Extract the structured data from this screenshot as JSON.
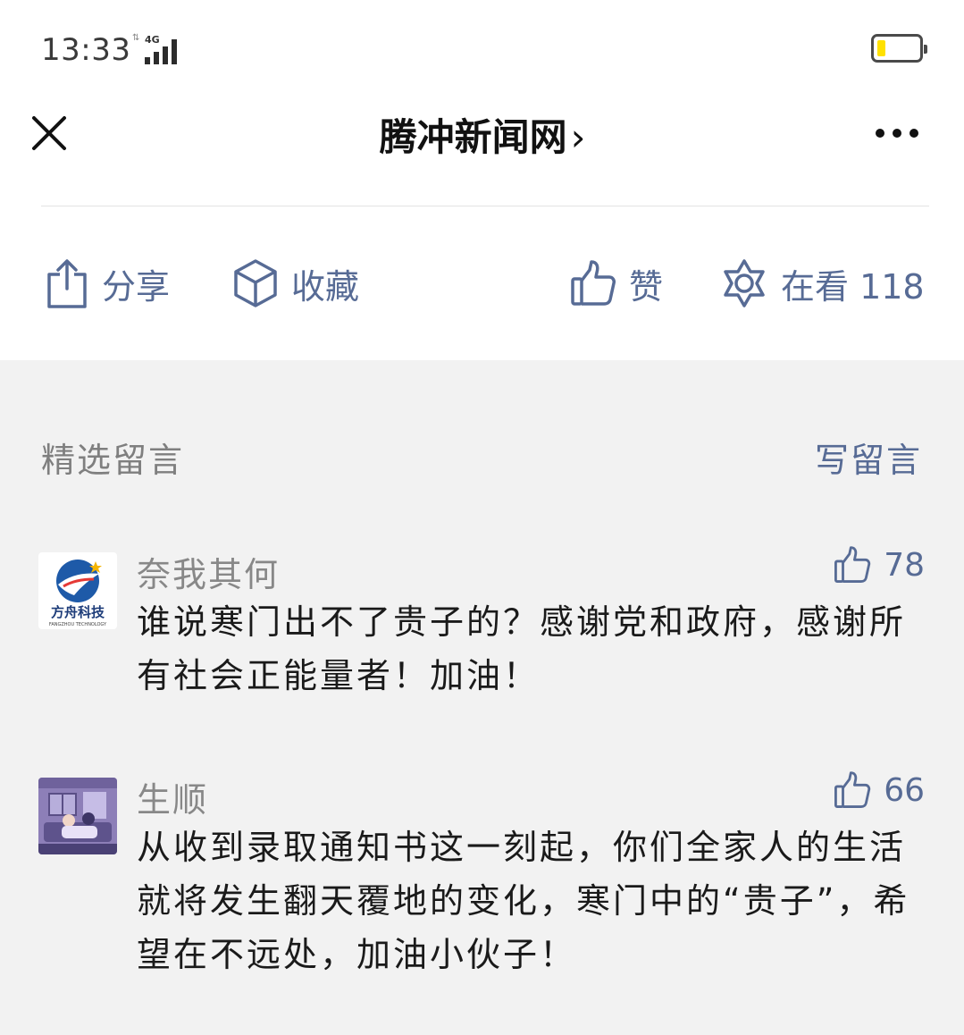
{
  "status_bar": {
    "time": "13:33",
    "network": "4G",
    "battery_level": 0.2,
    "battery_color": "#ffe100"
  },
  "nav": {
    "close_icon": "close-icon",
    "title": "腾冲新闻网",
    "title_chevron": "›",
    "more_icon": "more-icon"
  },
  "actions": {
    "share_label": "分享",
    "favorite_label": "收藏",
    "like_label": "赞",
    "watching_label": "在看 118"
  },
  "comments_section": {
    "title": "精选留言",
    "write_label": "写留言",
    "items": [
      {
        "nickname": "奈我其何",
        "avatar_text": "方舟科技",
        "avatar_subtext": "FANGZHOU TECHNOLOGY",
        "likes": "78",
        "text": "谁说寒门出不了贵子的？感谢党和政府，感谢所有社会正能量者！加油！"
      },
      {
        "nickname": "生顺",
        "likes": "66",
        "text": "从收到录取通知书这一刻起，你们全家人的生活就将发生翻天覆地的变化，寒门中的“贵子”，希望在不远处，加油小伙子！"
      }
    ]
  },
  "colors": {
    "link": "#576b95",
    "secondary_text": "#888888",
    "background": "#f2f2f2"
  }
}
